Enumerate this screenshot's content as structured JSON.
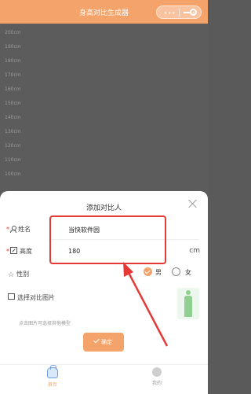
{
  "header": {
    "title": "身高对比生成器",
    "menu_icon": "more-dots-icon",
    "close_icon": "target-circle-icon"
  },
  "ruler": {
    "ticks": [
      "200cm",
      "190cm",
      "180cm",
      "170cm",
      "160cm",
      "150cm",
      "140cm",
      "130cm",
      "120cm",
      "110cm",
      "100cm"
    ]
  },
  "sheet": {
    "title": "添加对比人",
    "name_label": "姓名",
    "name_value": "当快软件园",
    "height_label": "高度",
    "height_value": "180",
    "height_unit": "cm",
    "gender_label": "性别",
    "gender_male": "男",
    "gender_female": "女",
    "gender_selected": "男",
    "image_label": "选择对比图片",
    "image_hint": "点击图片可选择其他模型",
    "confirm_label": "确定"
  },
  "tabbar": {
    "home_label": "首页",
    "mine_label": "我的"
  },
  "colors": {
    "accent": "#f4a36b",
    "highlight": "#e53935"
  }
}
